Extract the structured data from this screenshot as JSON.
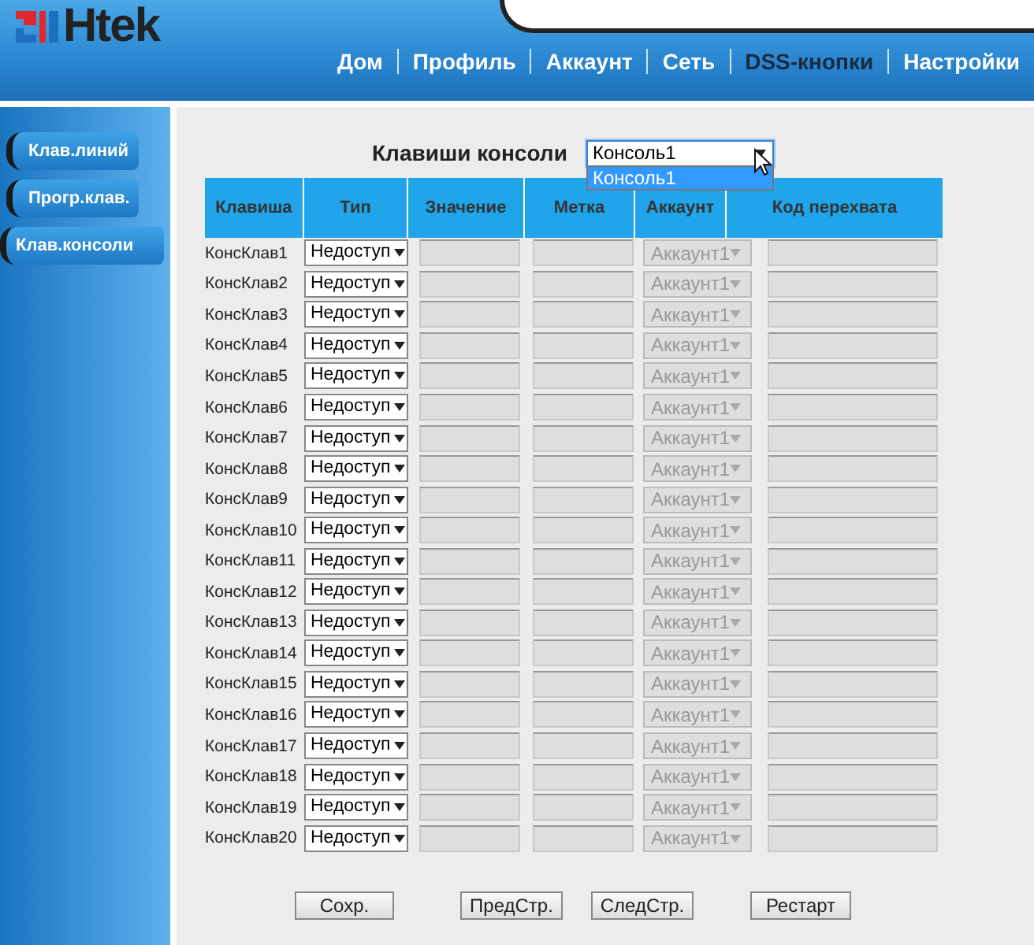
{
  "logo": "Htek",
  "nav": [
    {
      "label": "Дом",
      "selected": false
    },
    {
      "label": "Профиль",
      "selected": false
    },
    {
      "label": "Аккаунт",
      "selected": false
    },
    {
      "label": "Сеть",
      "selected": false
    },
    {
      "label": "DSS-кнопки",
      "selected": true
    },
    {
      "label": "Настройки",
      "selected": false
    }
  ],
  "sidebar": {
    "items": [
      {
        "label": "Клав.линий",
        "selected": false
      },
      {
        "label": "Прогр.клав.",
        "selected": false
      },
      {
        "label": "Клав.консоли",
        "selected": true
      }
    ]
  },
  "console": {
    "label": "Клавиши консоли",
    "value": "Консоль1",
    "expanded": true,
    "options": [
      {
        "label": "Консоль1",
        "selected": true
      }
    ]
  },
  "table": {
    "columns": [
      "Клавиша",
      "Тип",
      "Значение",
      "Метка",
      "Аккаунт",
      "Код перехвата"
    ],
    "rows": [
      {
        "key": "КонсКлав1",
        "type": "Недоступ",
        "account": "Аккаунт1",
        "disabled": true
      },
      {
        "key": "КонсКлав2",
        "type": "Недоступ",
        "account": "Аккаунт1",
        "disabled": true
      },
      {
        "key": "КонсКлав3",
        "type": "Недоступ",
        "account": "Аккаунт1",
        "disabled": true
      },
      {
        "key": "КонсКлав4",
        "type": "Недоступ",
        "account": "Аккаунт1",
        "disabled": true
      },
      {
        "key": "КонсКлав5",
        "type": "Недоступ",
        "account": "Аккаунт1",
        "disabled": true
      },
      {
        "key": "КонсКлав6",
        "type": "Недоступ",
        "account": "Аккаунт1",
        "disabled": true
      },
      {
        "key": "КонсКлав7",
        "type": "Недоступ",
        "account": "Аккаунт1",
        "disabled": true
      },
      {
        "key": "КонсКлав8",
        "type": "Недоступ",
        "account": "Аккаунт1",
        "disabled": true
      },
      {
        "key": "КонсКлав9",
        "type": "Недоступ",
        "account": "Аккаунт1",
        "disabled": true
      },
      {
        "key": "КонсКлав10",
        "type": "Недоступ",
        "account": "Аккаунт1",
        "disabled": true
      },
      {
        "key": "КонсКлав11",
        "type": "Недоступ",
        "account": "Аккаунт1",
        "disabled": true
      },
      {
        "key": "КонсКлав12",
        "type": "Недоступ",
        "account": "Аккаунт1",
        "disabled": true
      },
      {
        "key": "КонсКлав13",
        "type": "Недоступ",
        "account": "Аккаунт1",
        "disabled": true
      },
      {
        "key": "КонсКлав14",
        "type": "Недоступ",
        "account": "Аккаунт1",
        "disabled": true
      },
      {
        "key": "КонсКлав15",
        "type": "Недоступ",
        "account": "Аккаунт1",
        "disabled": true
      },
      {
        "key": "КонсКлав16",
        "type": "Недоступ",
        "account": "Аккаунт1",
        "disabled": true
      },
      {
        "key": "КонсКлав17",
        "type": "Недоступ",
        "account": "Аккаунт1",
        "disabled": true
      },
      {
        "key": "КонсКлав18",
        "type": "Недоступ",
        "account": "Аккаунт1",
        "disabled": true
      },
      {
        "key": "КонсКлав19",
        "type": "Недоступ",
        "account": "Аккаунт1",
        "disabled": true
      },
      {
        "key": "КонсКлав20",
        "type": "Недоступ",
        "account": "Аккаунт1",
        "disabled": true
      }
    ]
  },
  "buttons": [
    "Сохр.",
    "ПредСтр.",
    "СледСтр.",
    "Рестарт"
  ]
}
